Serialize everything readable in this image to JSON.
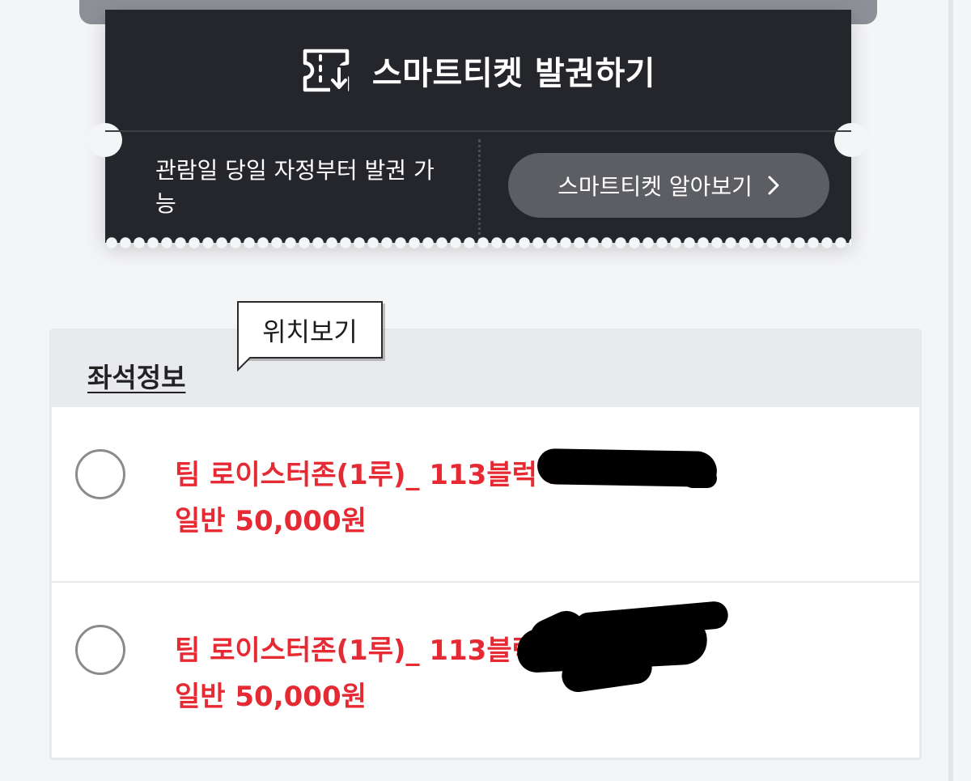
{
  "smart_ticket": {
    "icon": "ticket-download-icon",
    "title": "스마트티켓 발권하기",
    "description": "관람일 당일 자정부터 발권 가능",
    "learn_more_label": "스마트티켓 알아보기",
    "learn_more_icon": "chevron-right-icon"
  },
  "seat_info": {
    "header": "좌석정보",
    "tooltip": "위치보기",
    "seats": [
      {
        "name": "팀 로이스터존(1루)_ 113블럭 1",
        "price": "일반 50,000원"
      },
      {
        "name": "팀 로이스터존(1루)_ 113블럭",
        "price": "일반 50,000원"
      }
    ]
  },
  "colors": {
    "ticket_bg": "#25262b",
    "button_bg": "#5c5e63",
    "seat_text": "#e52a33",
    "page_bg": "#f4f5f7"
  }
}
